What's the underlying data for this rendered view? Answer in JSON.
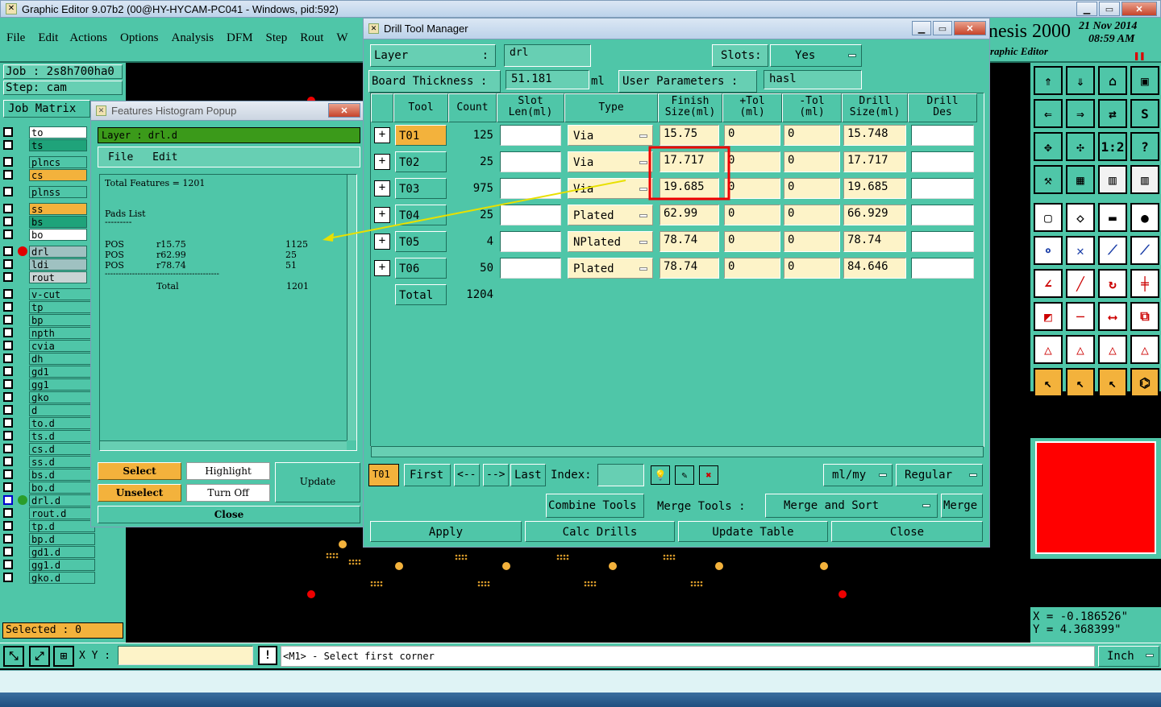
{
  "main_window": {
    "title": "Graphic Editor 9.07b2 (00@HY-HYCAM-PC041 - Windows, pid:592)",
    "menu": [
      "File",
      "Edit",
      "Actions",
      "Options",
      "Analysis",
      "DFM",
      "Step",
      "Rout",
      "W"
    ],
    "brand": "nesis 2000",
    "brand_sub": "raphic Editor",
    "date": "21 Nov 2014",
    "time": "08:59 AM",
    "job_label": "Job : 2s8h700ha0",
    "step_label": "Step: cam",
    "job_matrix_label": "Job Matrix",
    "selected_label": "Selected : 0",
    "xy_label": "X Y :",
    "xy_value": "",
    "prompt": "<M1> - Select first corner",
    "unit_button": "Inch",
    "coord_x": "X  = -0.186526\"",
    "coord_y": "Y  = 4.368399\""
  },
  "layers": [
    {
      "name": "to",
      "color": "#ffffff"
    },
    {
      "name": "ts",
      "color": "#1fa37a"
    },
    {
      "name": "plncs",
      "color": "#4fc6a8"
    },
    {
      "name": "cs",
      "color": "#f3b23c"
    },
    {
      "name": "plnss",
      "color": "#4fc6a8"
    },
    {
      "name": "ss",
      "color": "#f3b23c"
    },
    {
      "name": "bs",
      "color": "#1fa37a"
    },
    {
      "name": "bo",
      "color": "#ffffff"
    },
    {
      "name": "drl",
      "color": "#9fc1c1"
    },
    {
      "name": "ldi",
      "color": "#9fc1c1"
    },
    {
      "name": "rout",
      "color": "#c8d4d4"
    },
    {
      "name": "v-cut",
      "color": "#4fc6a8"
    },
    {
      "name": "tp",
      "color": "#4fc6a8"
    },
    {
      "name": "bp",
      "color": "#4fc6a8"
    },
    {
      "name": "npth",
      "color": "#4fc6a8"
    },
    {
      "name": "cvia",
      "color": "#4fc6a8"
    },
    {
      "name": "dh",
      "color": "#4fc6a8"
    },
    {
      "name": "gd1",
      "color": "#4fc6a8"
    },
    {
      "name": "gg1",
      "color": "#4fc6a8"
    },
    {
      "name": "gko",
      "color": "#4fc6a8"
    },
    {
      "name": "d",
      "color": "#4fc6a8"
    },
    {
      "name": "to.d",
      "color": "#4fc6a8"
    },
    {
      "name": "ts.d",
      "color": "#4fc6a8"
    },
    {
      "name": "cs.d",
      "color": "#4fc6a8"
    },
    {
      "name": "ss.d",
      "color": "#4fc6a8"
    },
    {
      "name": "bs.d",
      "color": "#4fc6a8"
    },
    {
      "name": "bo.d",
      "color": "#4fc6a8"
    },
    {
      "name": "drl.d",
      "color": "#4fc6a8"
    },
    {
      "name": "rout.d",
      "color": "#4fc6a8"
    },
    {
      "name": "tp.d",
      "color": "#4fc6a8"
    },
    {
      "name": "bp.d",
      "color": "#4fc6a8"
    },
    {
      "name": "gd1.d",
      "color": "#4fc6a8"
    },
    {
      "name": "gg1.d",
      "color": "#4fc6a8"
    },
    {
      "name": "gko.d",
      "color": "#4fc6a8"
    }
  ],
  "histogram": {
    "title": "Features Histogram Popup",
    "layer_label": "Layer :  drl.d",
    "menu": [
      "File",
      "Edit"
    ],
    "total_features": "Total Features = 1201",
    "pads_list": "Pads List",
    "underline": "---------",
    "rows": [
      {
        "kind": "POS",
        "sym": "r15.75",
        "count": "1125"
      },
      {
        "kind": "POS",
        "sym": "r62.99",
        "count": "25"
      },
      {
        "kind": "POS",
        "sym": "r78.74",
        "count": "51"
      }
    ],
    "separator": "------------------------------------------",
    "total_label": "Total",
    "total_value": "1201",
    "select": "Select",
    "highlight": "Highlight",
    "update": "Update",
    "unselect": "Unselect",
    "turn_off": "Turn Off",
    "close": "Close"
  },
  "drill": {
    "title": "Drill Tool Manager",
    "layer_label": "Layer",
    "layer_colon": ":",
    "layer_value": "drl",
    "slots_label": "Slots:",
    "slots_value": "Yes",
    "board_thickness_label": "Board Thickness :",
    "board_thickness_value": "51.181",
    "board_thickness_unit": "ml",
    "user_params_label": "User Parameters :",
    "user_params_value": "hasl",
    "headers": {
      "tool": "Tool",
      "count": "Count",
      "slot1": "Slot",
      "slot2": "Len(ml)",
      "type": "Type",
      "finish1": "Finish",
      "finish2": "Size(ml)",
      "ptol1": "+Tol",
      "ptol2": "(ml)",
      "mtol1": "-Tol",
      "mtol2": "(ml)",
      "dsize1": "Drill",
      "dsize2": "Size(ml)",
      "ddes1": "Drill",
      "ddes2": "Des"
    },
    "tools": [
      {
        "tool": "T01",
        "count": "125",
        "slot": "",
        "type": "Via",
        "finish": "15.75",
        "ptol": "0",
        "mtol": "0",
        "drill": "15.748",
        "des": ""
      },
      {
        "tool": "T02",
        "count": "25",
        "slot": "",
        "type": "Via",
        "finish": "17.717",
        "ptol": "0",
        "mtol": "0",
        "drill": "17.717",
        "des": ""
      },
      {
        "tool": "T03",
        "count": "975",
        "slot": "",
        "type": "Via",
        "finish": "19.685",
        "ptol": "0",
        "mtol": "0",
        "drill": "19.685",
        "des": ""
      },
      {
        "tool": "T04",
        "count": "25",
        "slot": "",
        "type": "Plated",
        "finish": "62.99",
        "ptol": "0",
        "mtol": "0",
        "drill": "66.929",
        "des": ""
      },
      {
        "tool": "T05",
        "count": "4",
        "slot": "",
        "type": "NPlated",
        "finish": "78.74",
        "ptol": "0",
        "mtol": "0",
        "drill": "78.74",
        "des": ""
      },
      {
        "tool": "T06",
        "count": "50",
        "slot": "",
        "type": "Plated",
        "finish": "78.74",
        "ptol": "0",
        "mtol": "0",
        "drill": "84.646",
        "des": ""
      }
    ],
    "total_label": "Total",
    "total_count": "1204",
    "current_tool": "T01",
    "first": "First",
    "prev": "<--",
    "next": "-->",
    "last": "Last",
    "index_label": "Index:",
    "index_value": "",
    "units": "ml/my",
    "mode": "Regular",
    "combine_tools": "Combine Tools",
    "merge_tools_label": "Merge Tools :",
    "merge_option": "Merge and Sort",
    "merge": "Merge",
    "apply": "Apply",
    "calc_drills": "Calc Drills",
    "update_table": "Update Table",
    "close": "Close"
  }
}
